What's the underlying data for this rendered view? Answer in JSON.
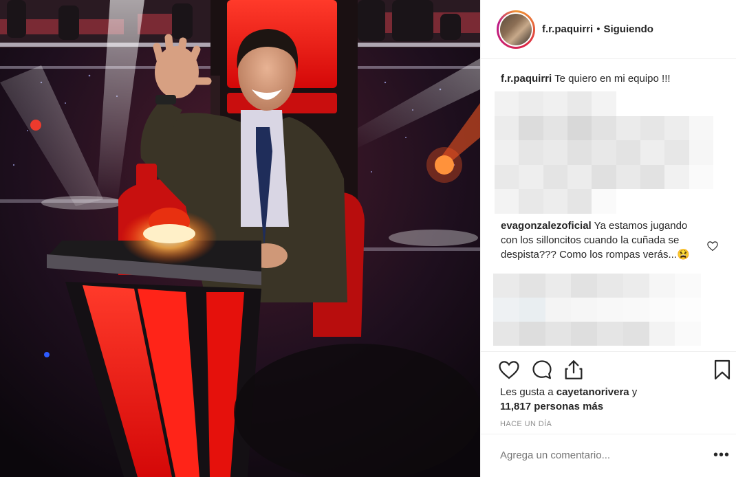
{
  "post": {
    "username": "f.r.paquirri",
    "separator": "•",
    "follow_status": "Siguiendo",
    "caption_user": "f.r.paquirri",
    "caption_text": "Te quiero en mi equipo !!!",
    "comment_user": "evagonzalezoficial",
    "comment_text": "Ya estamos jugando con los silloncitos cuando la cuñada se despista??? Como los rompas verás...😫",
    "likes_prefix": "Les gusta a ",
    "likes_user": "cayetanorivera",
    "likes_middle": " y ",
    "likes_count": "11,817 personas más",
    "time_ago": "HACE UN DÍA",
    "add_comment_placeholder": "Agrega un comentario...",
    "more_options": "•••"
  },
  "icons": {
    "like": "heart-icon",
    "comment": "comment-bubble-icon",
    "share": "share-icon",
    "save": "bookmark-icon",
    "comment_like": "small-heart-icon"
  },
  "colors": {
    "text": "#262626",
    "muted": "#8e8e8e",
    "border": "#efefef",
    "chair_red": "#e0110e"
  }
}
